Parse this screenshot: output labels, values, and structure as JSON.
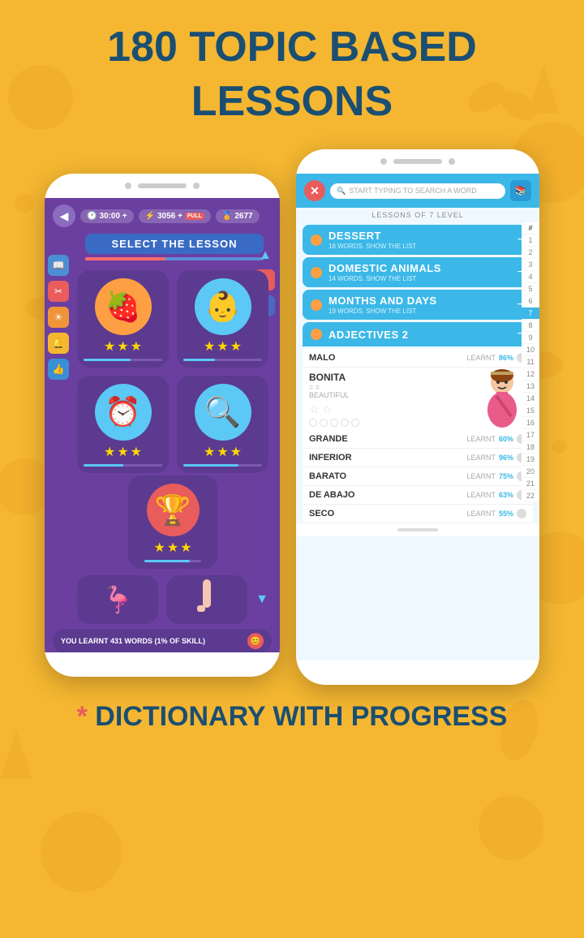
{
  "headline": {
    "line1": "180 TOPIC BASED",
    "line2": "LESSONS"
  },
  "left_phone": {
    "header": {
      "timer": "30:00 +",
      "xp": "3056 +",
      "xp_badge": "FULL",
      "coins": "2677"
    },
    "title": "SELECT THE LESSON",
    "lessons": [
      {
        "icon": "🍓",
        "bg": "#FF9F43",
        "stars": 3,
        "progress": 60
      },
      {
        "icon": "👶",
        "bg": "#5BC8F5",
        "stars": 3,
        "progress": 40
      },
      {
        "icon": "⏰",
        "bg": "#5BC8F5",
        "stars": 3,
        "progress": 50
      },
      {
        "icon": "🔍",
        "bg": "#5BC8F5",
        "stars": 3,
        "progress": 70
      },
      {
        "icon": "🏆",
        "bg": "#E85C5C",
        "stars": 3,
        "progress": 80
      }
    ],
    "footer_text": "YOU LEARNT 431 WORDS (1% OF SKILL)"
  },
  "right_phone": {
    "search_placeholder": "START TYPING TO SEARCH A WORD",
    "level_label": "LESSONS OF 7 LEVEL",
    "lessons": [
      {
        "name": "DESSERT",
        "sub": "16 WORDS. SHOW THE LIST",
        "dot_color": "#FF9F43"
      },
      {
        "name": "DOMESTIC ANIMALS",
        "sub": "14 WORDS. SHOW THE LIST",
        "dot_color": "#FF9F43"
      },
      {
        "name": "MONTHS AND DAYS",
        "sub": "19 WORDS. SHOW THE LIST",
        "dot_color": "#FF9F43"
      }
    ],
    "expanded_lesson": {
      "name": "ADJECTIVES 2",
      "dot_color": "#FF9F43"
    },
    "words": [
      {
        "name": "MALO",
        "learnt": "LEARNT",
        "pct": "86%"
      },
      {
        "name": "BONITA",
        "translation": "BEAUTIFUL",
        "expanded": true
      },
      {
        "name": "GRANDE",
        "learnt": "LEARNT",
        "pct": "60%"
      },
      {
        "name": "INFERIOR",
        "learnt": "LEARNT",
        "pct": "96%"
      },
      {
        "name": "BARATO",
        "learnt": "LEARNT",
        "pct": "75%"
      },
      {
        "name": "DE ABAJO",
        "learnt": "LEARNT",
        "pct": "63%"
      },
      {
        "name": "SECO",
        "learnt": "LEARNT",
        "pct": "55%"
      }
    ],
    "numbers": [
      "#",
      "1",
      "2",
      "3",
      "4",
      "5",
      "6",
      "7",
      "8",
      "9",
      "10",
      "11",
      "12",
      "13",
      "14",
      "15",
      "16",
      "17",
      "18",
      "19",
      "20",
      "21",
      "22"
    ]
  },
  "bottom_text": "* DICTIONARY WITH PROGRESS"
}
